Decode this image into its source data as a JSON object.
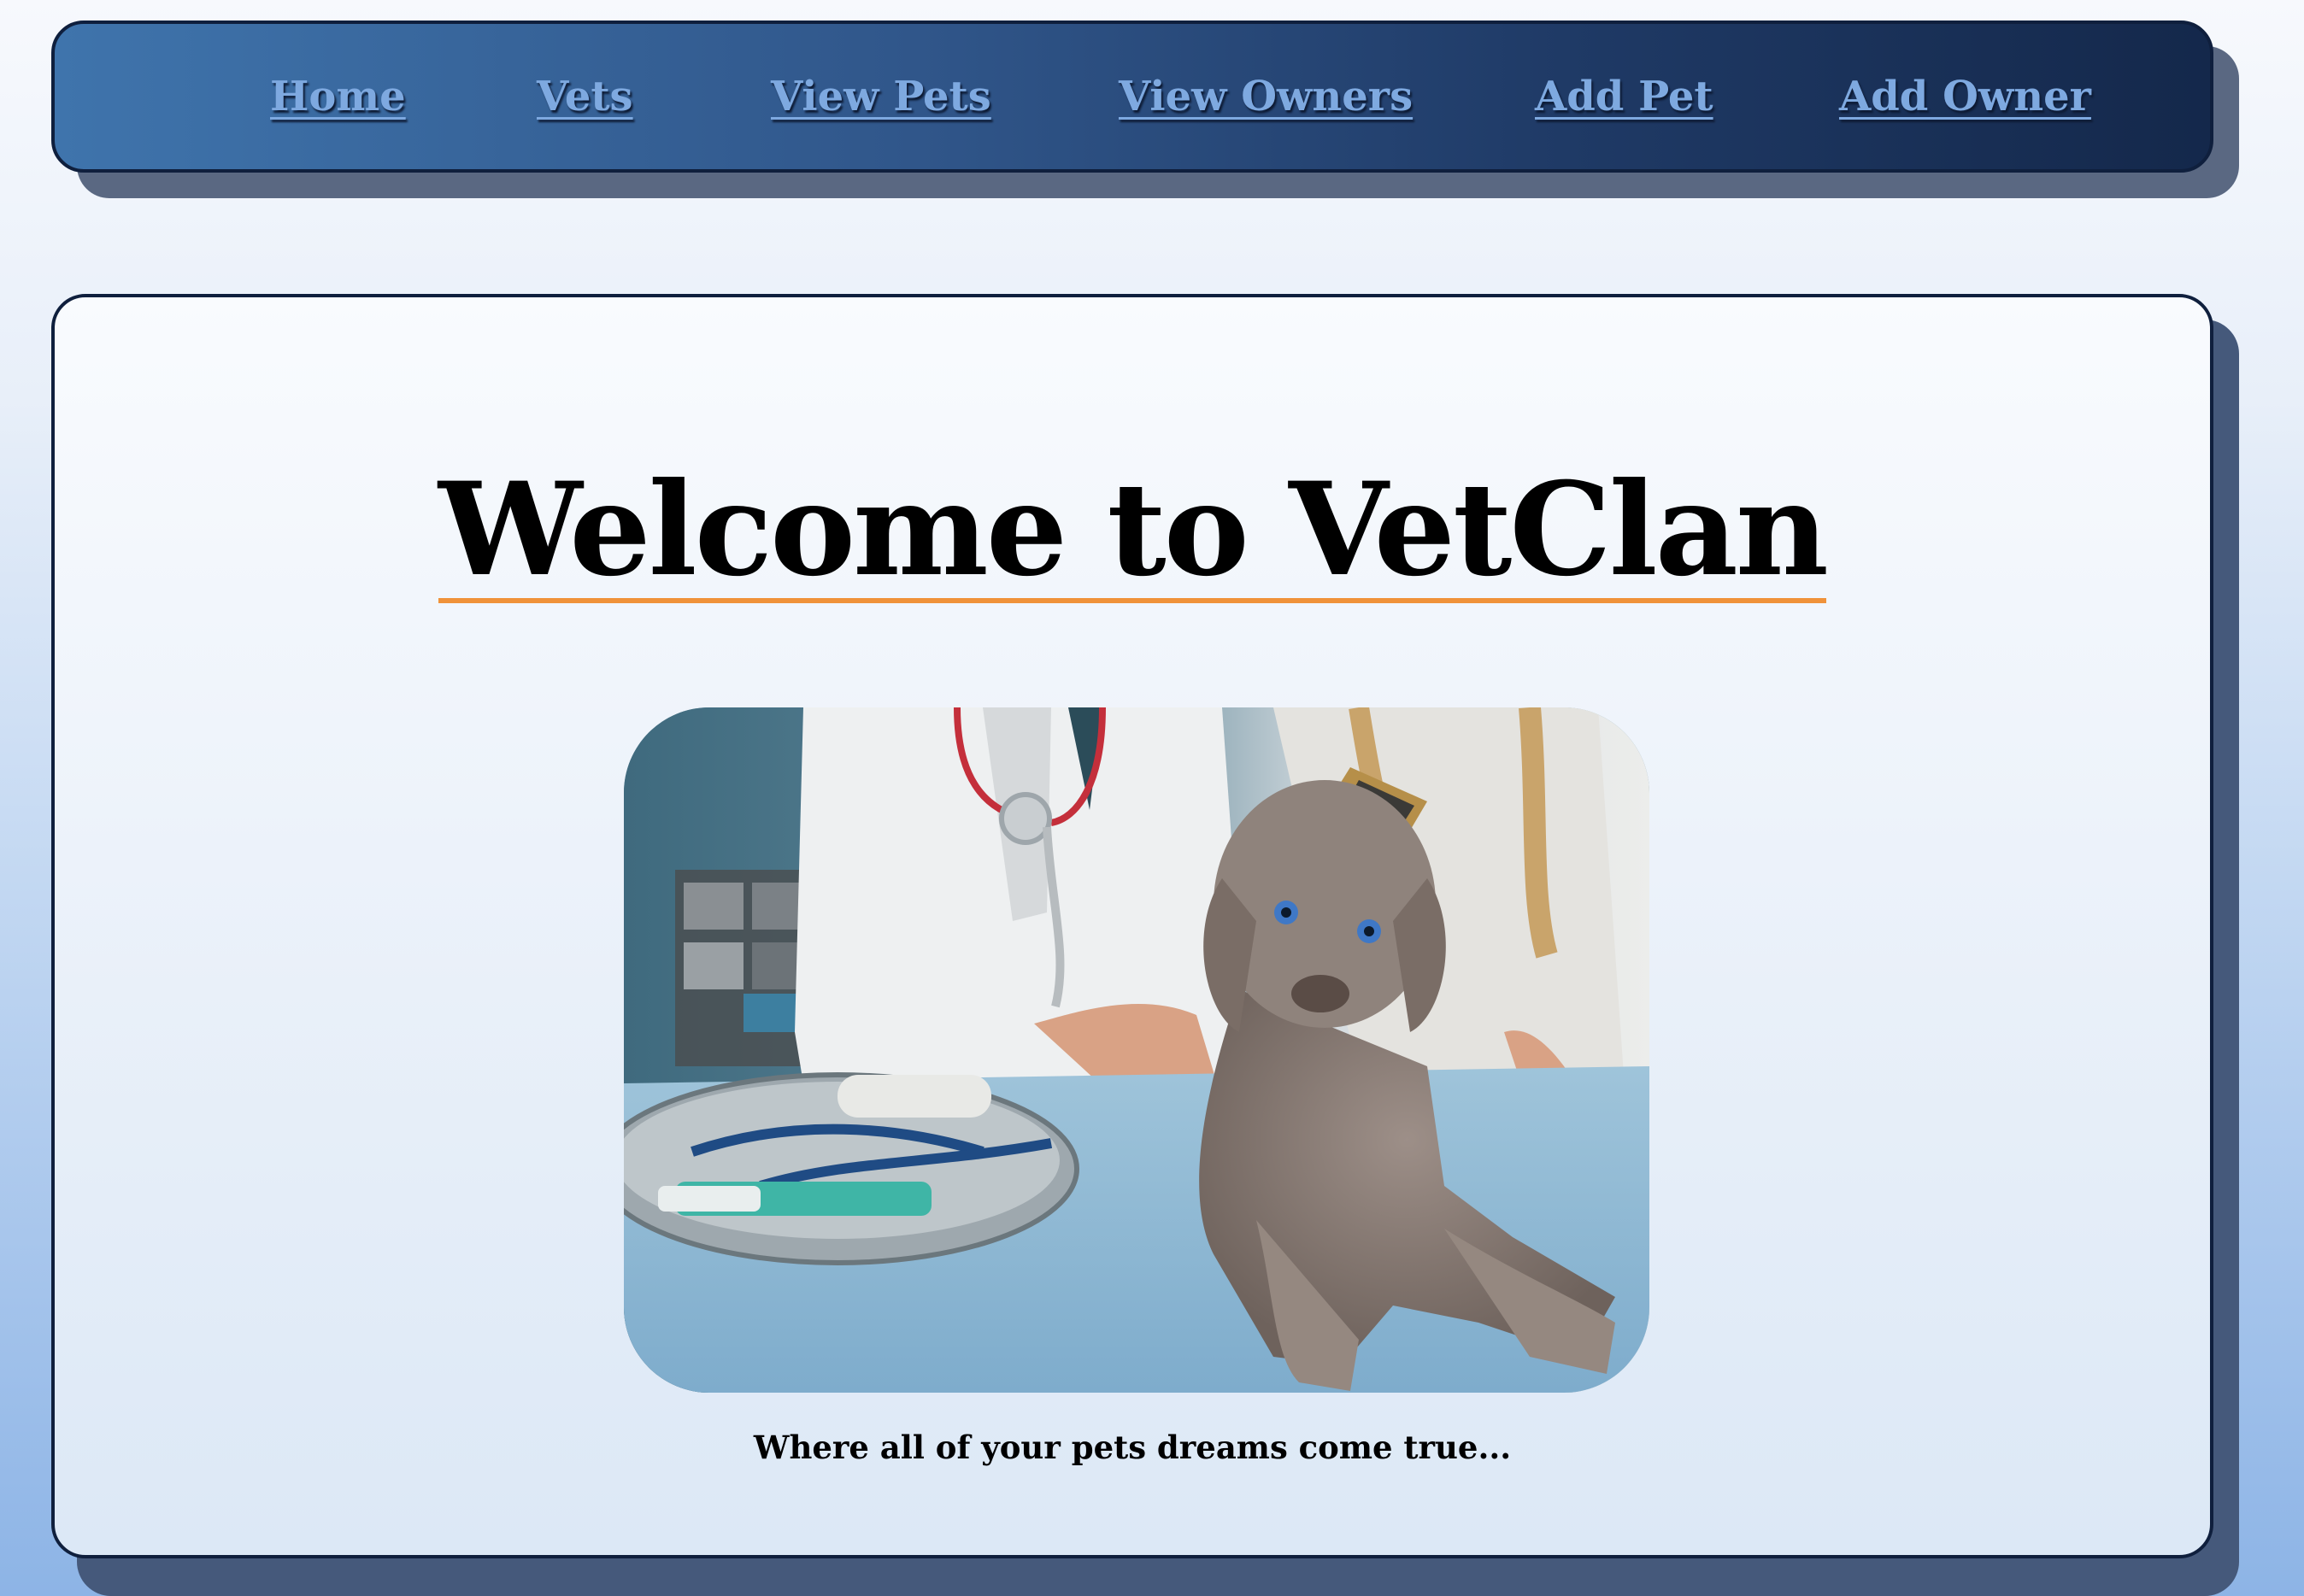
{
  "nav": {
    "items": [
      {
        "label": "Home"
      },
      {
        "label": "Vets"
      },
      {
        "label": "View Pets"
      },
      {
        "label": "View Owners"
      },
      {
        "label": "Add Pet"
      },
      {
        "label": "Add Owner"
      }
    ]
  },
  "main": {
    "title": "Welcome to VetClan",
    "tagline": "Where all of your pets dreams come true..."
  },
  "colors": {
    "nav_link": "#7ea9e0",
    "title_underline": "#f0923a",
    "border": "#0f1f3d"
  }
}
